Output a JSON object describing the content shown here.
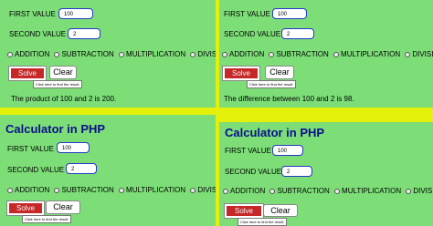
{
  "labels": {
    "first_value": "FIRST VALUE",
    "second_value": "SECOND VALUE",
    "solve": "Solve",
    "clear": "Clear",
    "tooltip": "Click here to find the result.",
    "app_title": "Calculator in PHP"
  },
  "operations": {
    "addition": "ADDITION",
    "subtraction": "SUBTRACTION",
    "multiplication": "MULTIPLICATION",
    "division": "DIVISION"
  },
  "panels": {
    "tl": {
      "first": "100",
      "second": "2",
      "result": "The product of 100 and 2 is 200."
    },
    "tr": {
      "first": "100",
      "second": "2",
      "result": "The difference between 100 and 2 is 98."
    },
    "bl": {
      "first": "100",
      "second": "2"
    },
    "br": {
      "first": "100",
      "second": "2"
    }
  },
  "colors": {
    "page_background": "#e4f00a",
    "panel_background": "#7dde78",
    "title": "#0a0f8a",
    "solve_button": "#c62828"
  }
}
